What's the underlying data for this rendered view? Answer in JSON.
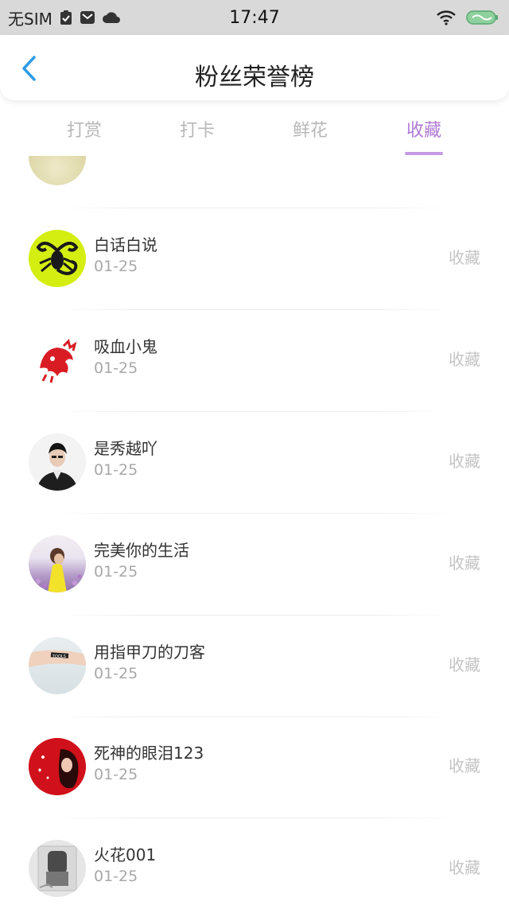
{
  "status_bar": {
    "carrier": "无SIM",
    "time": "17:47",
    "icons": [
      "clipboard-icon",
      "mail-icon",
      "cloud-icon",
      "wifi-icon",
      "battery-icon"
    ]
  },
  "header": {
    "title": "粉丝荣誉榜",
    "back_icon": "chevron-left-icon",
    "accent_color": "#2f9be6"
  },
  "tabs": [
    {
      "label": "打赏",
      "active": false
    },
    {
      "label": "打卡",
      "active": false
    },
    {
      "label": "鲜花",
      "active": false
    },
    {
      "label": "收藏",
      "active": true
    }
  ],
  "tab_active_color": "#b07ad6",
  "list": {
    "items": [
      {
        "name": "白话白说",
        "date": "01-25",
        "action": "收藏",
        "avatar": "scorpion-avatar"
      },
      {
        "name": "吸血小鬼",
        "date": "01-25",
        "action": "收藏",
        "avatar": "red-papercut-avatar"
      },
      {
        "name": "是秀越吖",
        "date": "01-25",
        "action": "收藏",
        "avatar": "man-portrait-avatar"
      },
      {
        "name": "完美你的生活",
        "date": "01-25",
        "action": "收藏",
        "avatar": "flower-field-avatar"
      },
      {
        "name": "用指甲刀的刀客",
        "date": "01-25",
        "action": "收藏",
        "avatar": "arm-tattoo-avatar"
      },
      {
        "name": "死神的眼泪123",
        "date": "01-25",
        "action": "收藏",
        "avatar": "red-girl-avatar"
      },
      {
        "name": "火花001",
        "date": "01-25",
        "action": "收藏",
        "avatar": "grayscale-avatar"
      }
    ]
  }
}
